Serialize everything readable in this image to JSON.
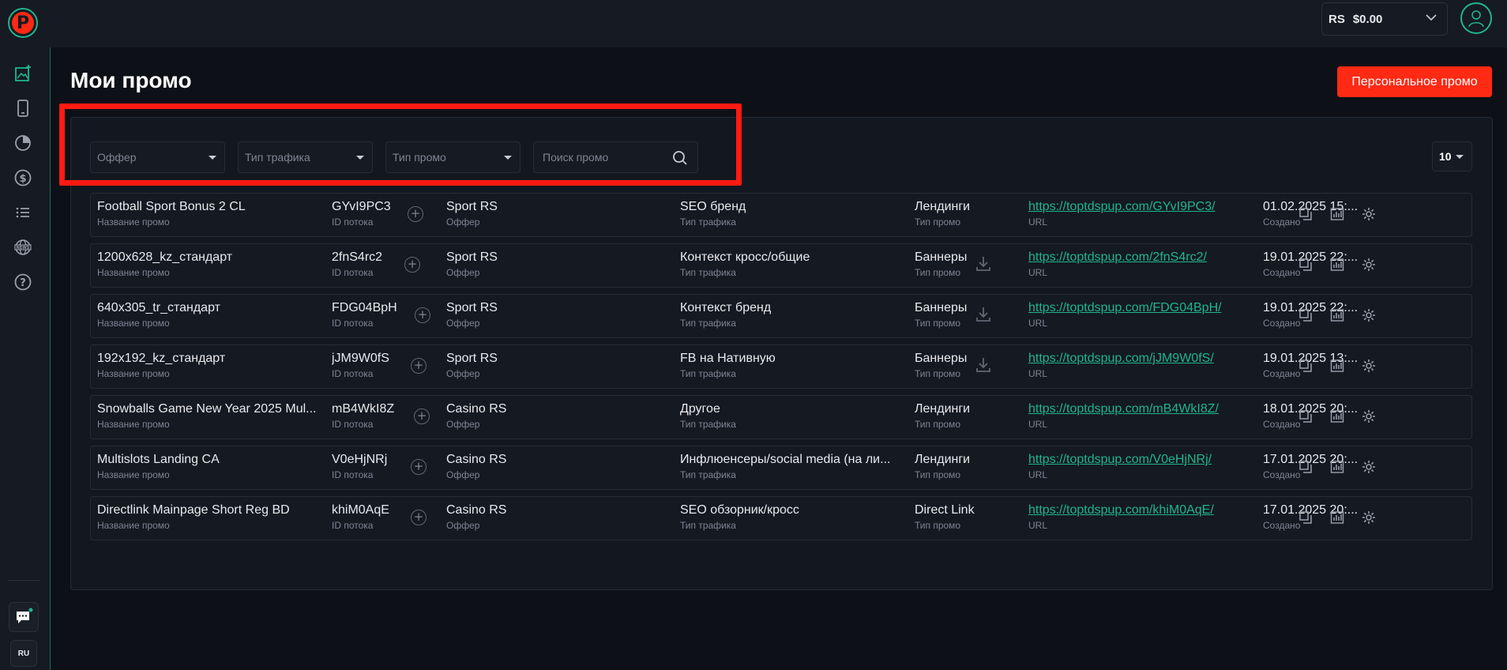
{
  "header": {
    "logo_letter": "P",
    "balance_currency": "RS",
    "balance_value": "$0.00",
    "language": "RU"
  },
  "page": {
    "title": "Мои промо",
    "personal_promo_button": "Персональное промо"
  },
  "filters": {
    "offer": "Оффер",
    "traffic_type": "Тип трафика",
    "promo_type": "Тип промо",
    "search_placeholder": "Поиск промо",
    "per_page": "10"
  },
  "labels": {
    "name": "Название промо",
    "id": "ID потока",
    "offer": "Оффер",
    "traffic": "Тип трафика",
    "ptype": "Тип промо",
    "url": "URL",
    "created": "Создано"
  },
  "rows": [
    {
      "name": "Football Sport Bonus 2 CL",
      "id": "GYvI9PC3",
      "offer": "Sport RS",
      "traffic": "SEO бренд",
      "ptype": "Лендинги",
      "url": "https://toptdspup.com/GYvI9PC3/",
      "created": "01.02.2025 15:...",
      "download": false
    },
    {
      "name": "1200x628_kz_стандарт",
      "id": "2fnS4rc2",
      "offer": "Sport RS",
      "traffic": "Контекст кросс/общие",
      "ptype": "Баннеры",
      "url": "https://toptdspup.com/2fnS4rc2/",
      "created": "19.01.2025 22:...",
      "download": true
    },
    {
      "name": "640x305_tr_стандарт",
      "id": "FDG04BpH",
      "offer": "Sport RS",
      "traffic": "Контекст бренд",
      "ptype": "Баннеры",
      "url": "https://toptdspup.com/FDG04BpH/",
      "created": "19.01.2025 22:...",
      "download": true
    },
    {
      "name": "192x192_kz_стандарт",
      "id": "jJM9W0fS",
      "offer": "Sport RS",
      "traffic": "FB на Нативную",
      "ptype": "Баннеры",
      "url": "https://toptdspup.com/jJM9W0fS/",
      "created": "19.01.2025 13:...",
      "download": true
    },
    {
      "name": "Snowballs Game New Year 2025 Mul...",
      "id": "mB4WkI8Z",
      "offer": "Casino RS",
      "traffic": "Другое",
      "ptype": "Лендинги",
      "url": "https://toptdspup.com/mB4WkI8Z/",
      "created": "18.01.2025 20:...",
      "download": false
    },
    {
      "name": "Multislots Landing CA",
      "id": "V0eHjNRj",
      "offer": "Casino RS",
      "traffic": "Инфлюенсеры/social media (на ли...",
      "ptype": "Лендинги",
      "url": "https://toptdspup.com/V0eHjNRj/",
      "created": "17.01.2025 20:...",
      "download": false
    },
    {
      "name": "Directlink Mainpage Short Reg BD",
      "id": "khiM0AqE",
      "offer": "Casino RS",
      "traffic": "SEO обзорник/кросс",
      "ptype": "Direct Link",
      "url": "https://toptdspup.com/khiM0AqE/",
      "created": "17.01.2025 20:...",
      "download": false
    }
  ]
}
